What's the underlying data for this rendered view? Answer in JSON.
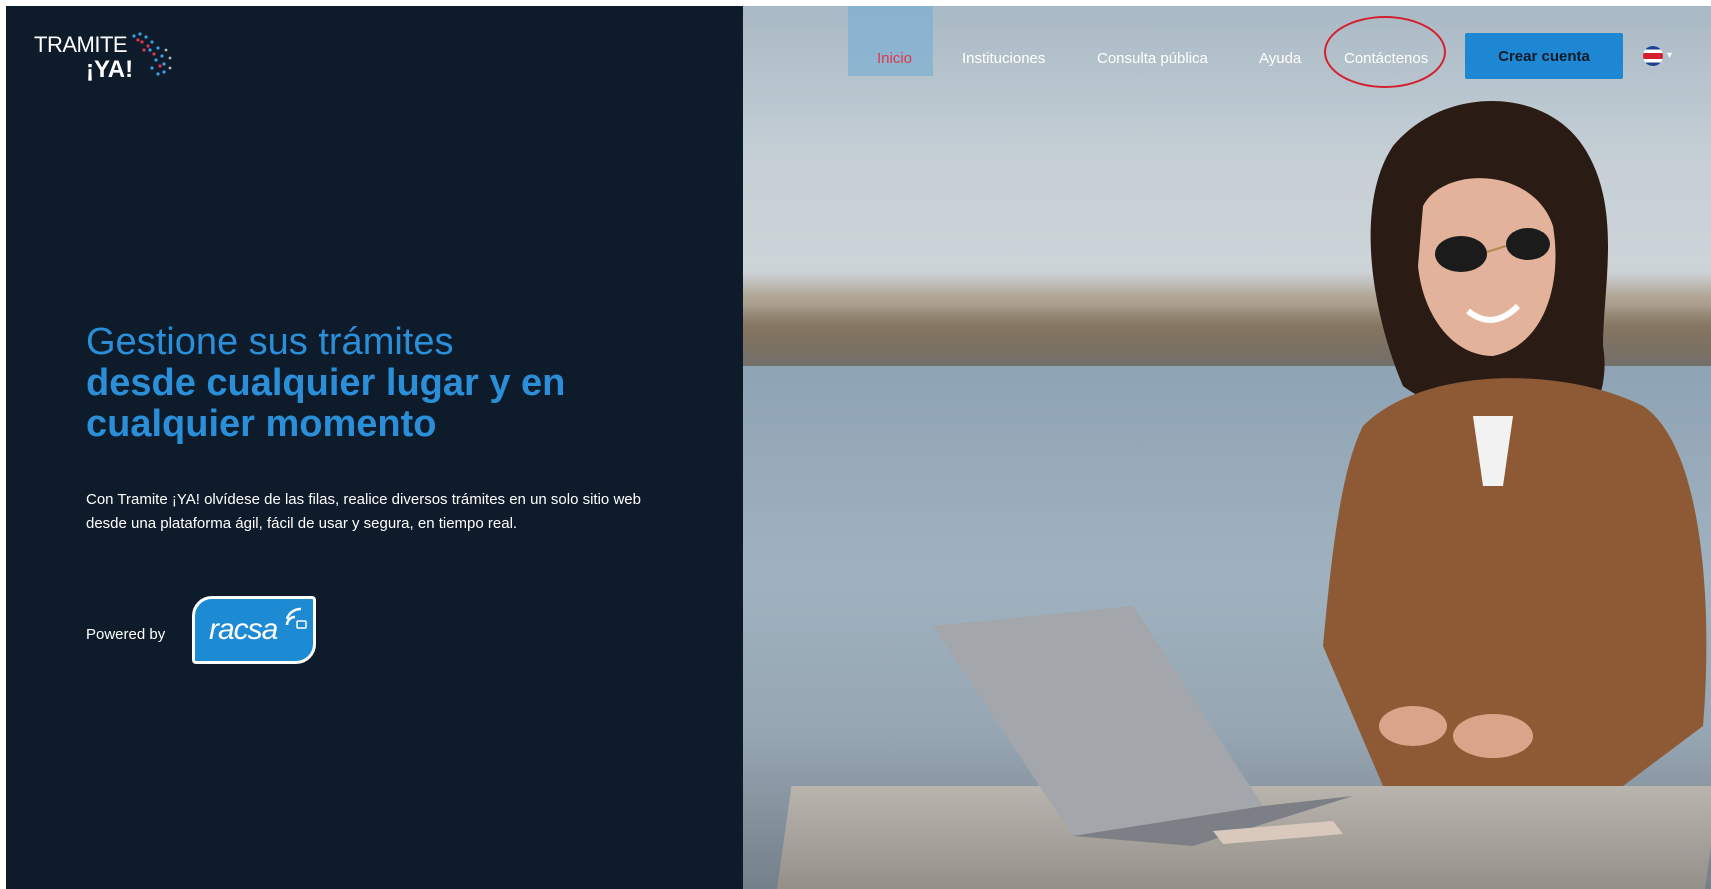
{
  "logo": {
    "line1": "TRAMITE",
    "line2": "¡YA!"
  },
  "nav": {
    "items": [
      {
        "label": "Inicio",
        "active": true
      },
      {
        "label": "Instituciones",
        "active": false
      },
      {
        "label": "Consulta pública",
        "active": false
      },
      {
        "label": "Ayuda",
        "active": false
      },
      {
        "label": "Contáctenos",
        "active": false
      }
    ],
    "create_account": "Crear cuenta",
    "language_flag_icon": "costa-rica-flag-icon"
  },
  "hero": {
    "title_line1": "Gestione sus trámites",
    "title_line2": "desde cualquier lugar y en",
    "title_line3": "cualquier momento",
    "description_line1": "Con Tramite ¡YA! olvídese de las filas, realice diversos trámites en un solo sitio web",
    "description_line2": "desde una plataforma ágil, fácil de usar y segura, en tiempo real.",
    "powered_by": "Powered by",
    "partner_logo": "racsa"
  },
  "colors": {
    "background": "#0d1b2a",
    "accent_blue": "#2a8fd8",
    "button_blue": "#1e87d3",
    "active_nav": "#e0364f",
    "highlight_circle": "#d4202e"
  }
}
